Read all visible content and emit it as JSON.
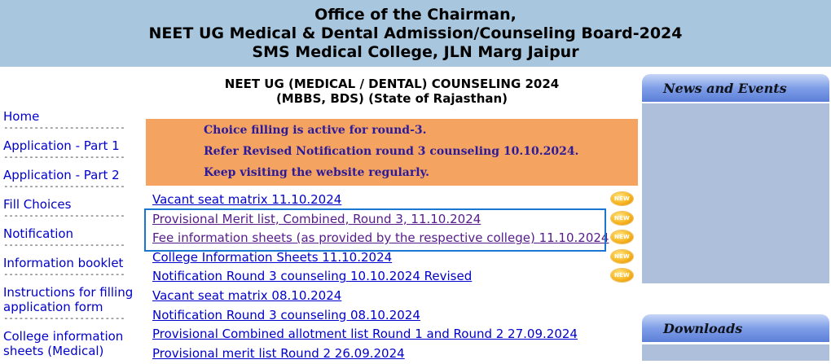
{
  "header": {
    "lines": [
      "Office of the Chairman,",
      "NEET UG Medical & Dental Admission/Counseling Board-2024",
      "SMS Medical College, JLN Marg Jaipur"
    ]
  },
  "sidebar": {
    "separator": "------------------------",
    "items": [
      {
        "label": "Home"
      },
      {
        "label": "Application - Part 1"
      },
      {
        "label": "Application - Part 2"
      },
      {
        "label": "Fill Choices"
      },
      {
        "label": "Notification"
      },
      {
        "label": "Information booklet"
      },
      {
        "label": "Instructions for filling application form"
      },
      {
        "label": "College information sheets (Medical)"
      }
    ]
  },
  "main": {
    "title_line1": "NEET UG (MEDICAL / DENTAL) COUNSELING 2024",
    "title_line2": "(MBBS, BDS) (State of Rajasthan)",
    "notice": {
      "background": "#f4a460",
      "text_color": "#2c1a9a",
      "lines": [
        "Choice filling is active for round-3.",
        "Refer Revised Notification round 3 counseling 10.10.2024.",
        "Keep visiting the website regularly."
      ]
    },
    "new_badge": "NEW",
    "links": [
      {
        "label": "Vacant seat matrix 11.10.2024",
        "is_new": true,
        "visited": false
      },
      {
        "label": "Provisional Merit list, Combined, Round 3, 11.10.2024",
        "is_new": true,
        "visited": true
      },
      {
        "label": "Fee information sheets (as provided by the respective college) 11.10.2024",
        "is_new": true,
        "visited": true
      },
      {
        "label": "College Information Sheets 11.10.2024",
        "is_new": true,
        "visited": false
      },
      {
        "label": "Notification Round 3 counseling 10.10.2024 Revised",
        "is_new": true,
        "visited": false
      },
      {
        "label": "Vacant seat matrix 08.10.2024",
        "is_new": false,
        "visited": false
      },
      {
        "label": "Notification Round 3 counseling 08.10.2024",
        "is_new": false,
        "visited": false
      },
      {
        "label": "Provisional Combined allotment list Round 1 and Round 2 27.09.2024",
        "is_new": false,
        "visited": false
      },
      {
        "label": "Provisional merit list Round 2 26.09.2024",
        "is_new": false,
        "visited": false
      }
    ]
  },
  "right_panel": {
    "news_title": "News and Events",
    "downloads_title": "Downloads"
  },
  "colors": {
    "header_bg": "#a8c6dd",
    "link": "#0000cc",
    "visited_link": "#551a8b",
    "highlight_border": "#1976d2",
    "panel_bg": "#aebfdb"
  }
}
